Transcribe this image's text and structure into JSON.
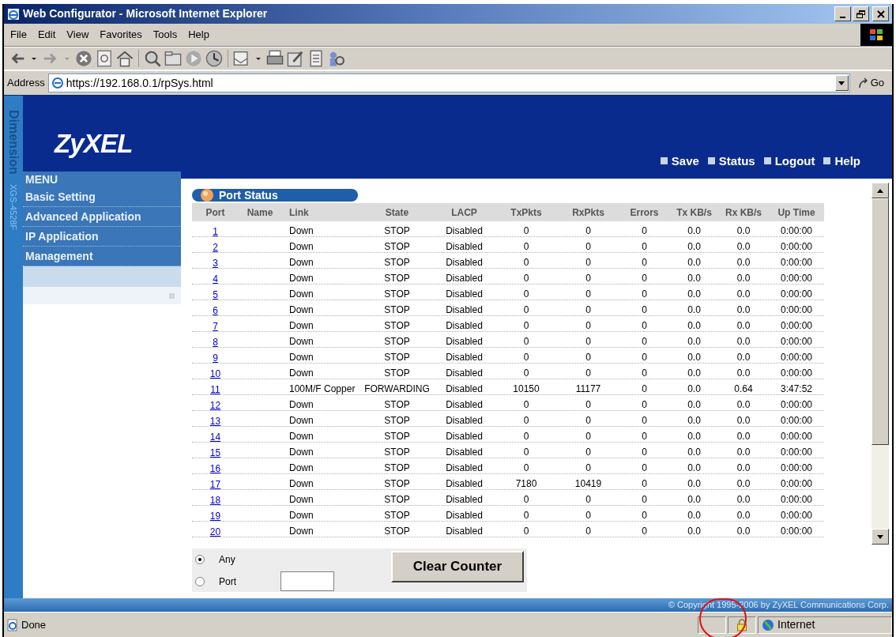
{
  "window": {
    "title": "Web Configurator - Microsoft Internet Explorer"
  },
  "menu_bar": [
    "File",
    "Edit",
    "View",
    "Favorites",
    "Tools",
    "Help"
  ],
  "address_bar": {
    "label": "Address",
    "value": "https://192.168.0.1/rpSys.html",
    "go": "Go"
  },
  "header": {
    "logo": "ZyXEL",
    "links": [
      "Save",
      "Status",
      "Logout",
      "Help"
    ]
  },
  "side_strip": {
    "product": "Dimension",
    "model": "XGS-4528F"
  },
  "menu": {
    "title": "MENU",
    "items": [
      "Basic Setting",
      "Advanced Application",
      "IP Application",
      "Management"
    ]
  },
  "port_status": {
    "title": "Port Status",
    "columns": [
      "Port",
      "Name",
      "Link",
      "State",
      "LACP",
      "TxPkts",
      "RxPkts",
      "Errors",
      "Tx KB/s",
      "Rx KB/s",
      "Up Time"
    ],
    "rows": [
      {
        "port": "1",
        "link": "Down",
        "state": "STOP",
        "lacp": "Disabled",
        "tx_pkts": "0",
        "rx_pkts": "0",
        "errors": "0",
        "tx_kbs": "0.0",
        "rx_kbs": "0.0",
        "up_time": "0:00:00"
      },
      {
        "port": "2",
        "link": "Down",
        "state": "STOP",
        "lacp": "Disabled",
        "tx_pkts": "0",
        "rx_pkts": "0",
        "errors": "0",
        "tx_kbs": "0.0",
        "rx_kbs": "0.0",
        "up_time": "0:00:00"
      },
      {
        "port": "3",
        "link": "Down",
        "state": "STOP",
        "lacp": "Disabled",
        "tx_pkts": "0",
        "rx_pkts": "0",
        "errors": "0",
        "tx_kbs": "0.0",
        "rx_kbs": "0.0",
        "up_time": "0:00:00"
      },
      {
        "port": "4",
        "link": "Down",
        "state": "STOP",
        "lacp": "Disabled",
        "tx_pkts": "0",
        "rx_pkts": "0",
        "errors": "0",
        "tx_kbs": "0.0",
        "rx_kbs": "0.0",
        "up_time": "0:00:00"
      },
      {
        "port": "5",
        "link": "Down",
        "state": "STOP",
        "lacp": "Disabled",
        "tx_pkts": "0",
        "rx_pkts": "0",
        "errors": "0",
        "tx_kbs": "0.0",
        "rx_kbs": "0.0",
        "up_time": "0:00:00"
      },
      {
        "port": "6",
        "link": "Down",
        "state": "STOP",
        "lacp": "Disabled",
        "tx_pkts": "0",
        "rx_pkts": "0",
        "errors": "0",
        "tx_kbs": "0.0",
        "rx_kbs": "0.0",
        "up_time": "0:00:00"
      },
      {
        "port": "7",
        "link": "Down",
        "state": "STOP",
        "lacp": "Disabled",
        "tx_pkts": "0",
        "rx_pkts": "0",
        "errors": "0",
        "tx_kbs": "0.0",
        "rx_kbs": "0.0",
        "up_time": "0:00:00"
      },
      {
        "port": "8",
        "link": "Down",
        "state": "STOP",
        "lacp": "Disabled",
        "tx_pkts": "0",
        "rx_pkts": "0",
        "errors": "0",
        "tx_kbs": "0.0",
        "rx_kbs": "0.0",
        "up_time": "0:00:00"
      },
      {
        "port": "9",
        "link": "Down",
        "state": "STOP",
        "lacp": "Disabled",
        "tx_pkts": "0",
        "rx_pkts": "0",
        "errors": "0",
        "tx_kbs": "0.0",
        "rx_kbs": "0.0",
        "up_time": "0:00:00"
      },
      {
        "port": "10",
        "link": "Down",
        "state": "STOP",
        "lacp": "Disabled",
        "tx_pkts": "0",
        "rx_pkts": "0",
        "errors": "0",
        "tx_kbs": "0.0",
        "rx_kbs": "0.0",
        "up_time": "0:00:00"
      },
      {
        "port": "11",
        "link": "100M/F Copper",
        "state": "FORWARDING",
        "lacp": "Disabled",
        "tx_pkts": "10150",
        "rx_pkts": "11177",
        "errors": "0",
        "tx_kbs": "0.0",
        "rx_kbs": "0.64",
        "up_time": "3:47:52"
      },
      {
        "port": "12",
        "link": "Down",
        "state": "STOP",
        "lacp": "Disabled",
        "tx_pkts": "0",
        "rx_pkts": "0",
        "errors": "0",
        "tx_kbs": "0.0",
        "rx_kbs": "0.0",
        "up_time": "0:00:00"
      },
      {
        "port": "13",
        "link": "Down",
        "state": "STOP",
        "lacp": "Disabled",
        "tx_pkts": "0",
        "rx_pkts": "0",
        "errors": "0",
        "tx_kbs": "0.0",
        "rx_kbs": "0.0",
        "up_time": "0:00:00"
      },
      {
        "port": "14",
        "link": "Down",
        "state": "STOP",
        "lacp": "Disabled",
        "tx_pkts": "0",
        "rx_pkts": "0",
        "errors": "0",
        "tx_kbs": "0.0",
        "rx_kbs": "0.0",
        "up_time": "0:00:00"
      },
      {
        "port": "15",
        "link": "Down",
        "state": "STOP",
        "lacp": "Disabled",
        "tx_pkts": "0",
        "rx_pkts": "0",
        "errors": "0",
        "tx_kbs": "0.0",
        "rx_kbs": "0.0",
        "up_time": "0:00:00"
      },
      {
        "port": "16",
        "link": "Down",
        "state": "STOP",
        "lacp": "Disabled",
        "tx_pkts": "0",
        "rx_pkts": "0",
        "errors": "0",
        "tx_kbs": "0.0",
        "rx_kbs": "0.0",
        "up_time": "0:00:00"
      },
      {
        "port": "17",
        "link": "Down",
        "state": "STOP",
        "lacp": "Disabled",
        "tx_pkts": "7180",
        "rx_pkts": "10419",
        "errors": "0",
        "tx_kbs": "0.0",
        "rx_kbs": "0.0",
        "up_time": "0:00:00"
      },
      {
        "port": "18",
        "link": "Down",
        "state": "STOP",
        "lacp": "Disabled",
        "tx_pkts": "0",
        "rx_pkts": "0",
        "errors": "0",
        "tx_kbs": "0.0",
        "rx_kbs": "0.0",
        "up_time": "0:00:00"
      },
      {
        "port": "19",
        "link": "Down",
        "state": "STOP",
        "lacp": "Disabled",
        "tx_pkts": "0",
        "rx_pkts": "0",
        "errors": "0",
        "tx_kbs": "0.0",
        "rx_kbs": "0.0",
        "up_time": "0:00:00"
      },
      {
        "port": "20",
        "link": "Down",
        "state": "STOP",
        "lacp": "Disabled",
        "tx_pkts": "0",
        "rx_pkts": "0",
        "errors": "0",
        "tx_kbs": "0.0",
        "rx_kbs": "0.0",
        "up_time": "0:00:00"
      }
    ]
  },
  "clear_form": {
    "options": [
      {
        "label": "Any",
        "selected": true
      },
      {
        "label": "Port",
        "selected": false
      }
    ],
    "button": "Clear Counter"
  },
  "copyright": "© Copyright 1995-2006 by ZyXEL Communications Corp.",
  "status_bar": {
    "text": "Done",
    "zone": "Internet"
  }
}
